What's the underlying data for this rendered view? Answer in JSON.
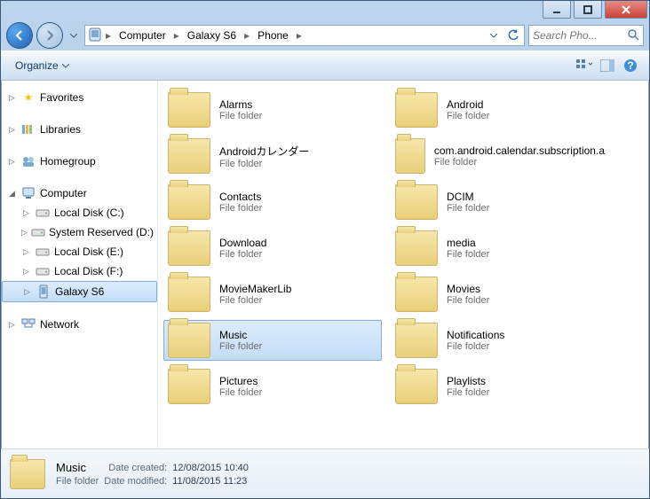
{
  "window": {},
  "breadcrumbs": {
    "root_icon": "device-icon",
    "items": [
      "Computer",
      "Galaxy S6",
      "Phone"
    ]
  },
  "search": {
    "placeholder": "Search Pho..."
  },
  "toolbar": {
    "organize_label": "Organize"
  },
  "nav": {
    "favorites": {
      "label": "Favorites"
    },
    "libraries": {
      "label": "Libraries"
    },
    "homegroup": {
      "label": "Homegroup"
    },
    "computer": {
      "label": "Computer",
      "children": [
        {
          "label": "Local Disk (C:)",
          "kind": "disk"
        },
        {
          "label": "System Reserved (D:)",
          "kind": "disk"
        },
        {
          "label": "Local Disk (E:)",
          "kind": "disk"
        },
        {
          "label": "Local Disk (F:)",
          "kind": "disk"
        },
        {
          "label": "Galaxy S6",
          "kind": "device",
          "selected": true
        }
      ]
    },
    "network": {
      "label": "Network"
    }
  },
  "folders": {
    "type_label": "File folder",
    "items": [
      {
        "name": "Alarms"
      },
      {
        "name": "Android"
      },
      {
        "name": "Androidカレンダー"
      },
      {
        "name": "com.android.calendar.subscription.a"
      },
      {
        "name": "Contacts"
      },
      {
        "name": "DCIM"
      },
      {
        "name": "Download"
      },
      {
        "name": "media"
      },
      {
        "name": "MovieMakerLib"
      },
      {
        "name": "Movies"
      },
      {
        "name": "Music",
        "selected": true
      },
      {
        "name": "Notifications"
      },
      {
        "name": "Pictures"
      },
      {
        "name": "Playlists"
      }
    ]
  },
  "details": {
    "name": "Music",
    "type": "File folder",
    "created_label": "Date created:",
    "created_value": "12/08/2015 10:40",
    "modified_label": "Date modified:",
    "modified_value": "11/08/2015 11:23"
  }
}
